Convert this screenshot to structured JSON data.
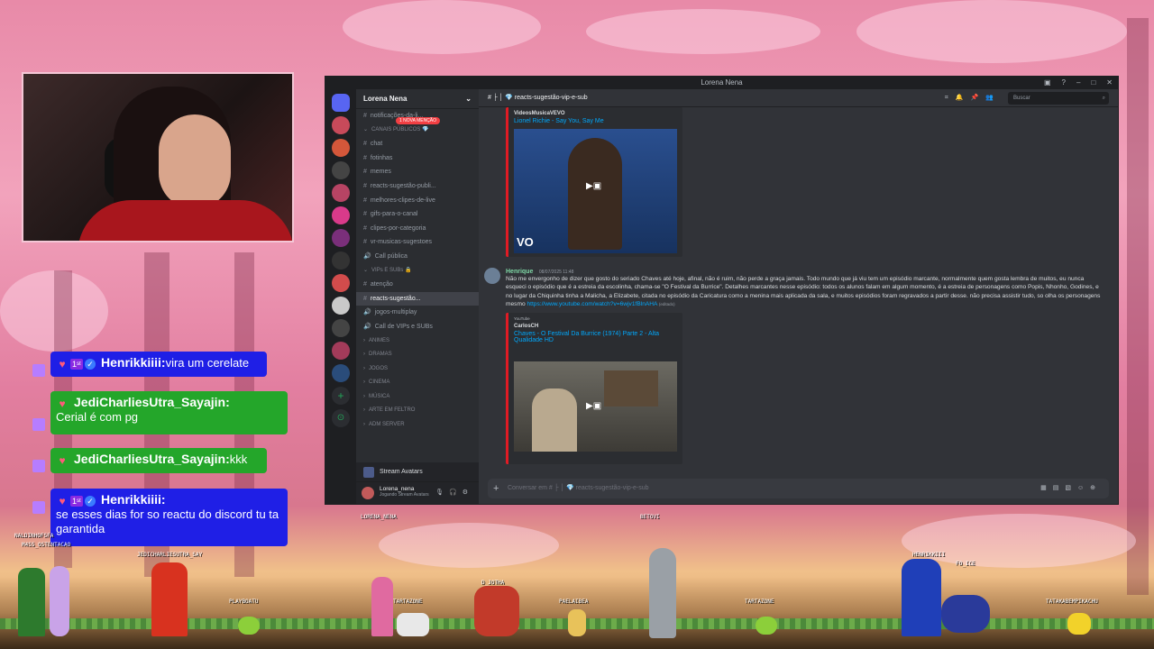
{
  "discord": {
    "window_title": "Lorena Nena",
    "server_name": "Lorena Nena",
    "mention_badge": "1 NOVA MENÇÃO",
    "active_channel": "reacts-sugestão-vip-e-sub",
    "search_placeholder": "Buscar",
    "composer_placeholder": "Conversar em # ├ │ 💎 reacts-sugestão-vip-e-sub",
    "channels": [
      {
        "label": "notificações-da-li...",
        "type": "text"
      },
      {
        "label": "CANAIS PÚBLICOS 💎",
        "type": "category"
      },
      {
        "label": "chat",
        "type": "text"
      },
      {
        "label": "fotinhas",
        "type": "text"
      },
      {
        "label": "memes",
        "type": "text"
      },
      {
        "label": "reacts-sugestão-publi...",
        "type": "text"
      },
      {
        "label": "melhores-clipes-de-live",
        "type": "text"
      },
      {
        "label": "gifs-para-o-canal",
        "type": "text"
      },
      {
        "label": "clipes-por-categoria",
        "type": "text"
      },
      {
        "label": "vr-musicas-sugestoes",
        "type": "text"
      },
      {
        "label": "Call pública",
        "type": "voice"
      },
      {
        "label": "VIPs E SUBs 🔒",
        "type": "category"
      },
      {
        "label": "atenção",
        "type": "text"
      },
      {
        "label": "reacts-sugestão...",
        "type": "text",
        "active": true
      },
      {
        "label": "jogos-multiplay",
        "type": "voice"
      },
      {
        "label": "Call de VIPs e SUBs",
        "type": "voice"
      },
      {
        "label": "ANIMES",
        "type": "category"
      },
      {
        "label": "DRAMAS",
        "type": "category"
      },
      {
        "label": "JOGOS",
        "type": "category"
      },
      {
        "label": "CINEMA",
        "type": "category"
      },
      {
        "label": "MÚSICA",
        "type": "category"
      },
      {
        "label": "ARTE EM FELTRO",
        "type": "category"
      },
      {
        "label": "ADM SERVER",
        "type": "category"
      }
    ],
    "activity": "Stream Avatars",
    "user": {
      "name": "Lorena_nena",
      "status": "Jogando Stream Avatars"
    },
    "embed1": {
      "provider": "VideosMusicaVEVO",
      "title": "Lionel Richie - Say You, Say Me",
      "watermark": "VO"
    },
    "message": {
      "author": "Henrique",
      "timestamp": "08/07/2025 11:48",
      "text": "Não me envergonho de dizer que gosto do seriado Chaves até hoje, afinal, não é ruim, não perde a graça jamais. Todo mundo que já viu tem um episódio marcante, normalmente quem gosta lembra de muitos, eu nunca esqueci o episódio que é a estreia da escolinha, chama-se \"O Festival da Burrice\". Detalhes marcantes nesse episódio: todos os alunos falam em algum momento, é a estreia de personagens como Popis, Nhonho, Godines, e no lugar da Chiquinha tinha a Malicha, a Elizabete, citada no episódio da Caricatura como a menina mais aplicada da sala, e muitos episódios foram regravados a partir desse. não precisa assistir tudo, so olha os personagens mesmo",
      "link": "https://www.youtube.com/watch?v=6wjv1fBlnAHA",
      "edited": "(editado)"
    },
    "embed2": {
      "provider_top": "YouTube",
      "provider": "CarlosCH",
      "title": "Chaves - O Festival Da Burrice (1974) Parte 2 - Alta Qualidade HD"
    }
  },
  "twitch_chat": [
    {
      "user": "Henrikkiiii",
      "sep": ":",
      "text": "vira um cerelate",
      "color": "#1f1fe6",
      "badges": [
        "heart",
        "1st",
        "verified"
      ]
    },
    {
      "user": "JediCharliesUtra_Sayajin",
      "sep": ":",
      "text": "Cerial é com pg",
      "color": "#24a62a",
      "badges": [
        "heart"
      ]
    },
    {
      "user": "JediCharliesUtra_Sayajin",
      "sep": ":",
      "text": "kkk",
      "color": "#24a62a",
      "badges": [
        "heart"
      ]
    },
    {
      "user": "Henrikkiiii",
      "sep": ":",
      "text": "se esses dias for so reactu do discord tu ta garantida",
      "color": "#1f1fe6",
      "badges": [
        "heart",
        "1st",
        "verified"
      ]
    }
  ],
  "avatars": [
    {
      "name": "LORENA_NENA"
    },
    {
      "name": "BETOVI"
    },
    {
      "name": "NALDINHOFSFA"
    },
    {
      "name": "M4SS_OSTENTACAO"
    },
    {
      "name": "JEDICHARLIESUTRA_SAY"
    },
    {
      "name": "PLAYBOATU"
    },
    {
      "name": "TARTAZONE"
    },
    {
      "name": "D_JOTHA"
    },
    {
      "name": "PAELAIBEA"
    },
    {
      "name": "TARTAZONE"
    },
    {
      "name": "HENRIKKIII"
    },
    {
      "name": "FO_ICE"
    },
    {
      "name": "TATAKABEMPIKACHU"
    }
  ]
}
